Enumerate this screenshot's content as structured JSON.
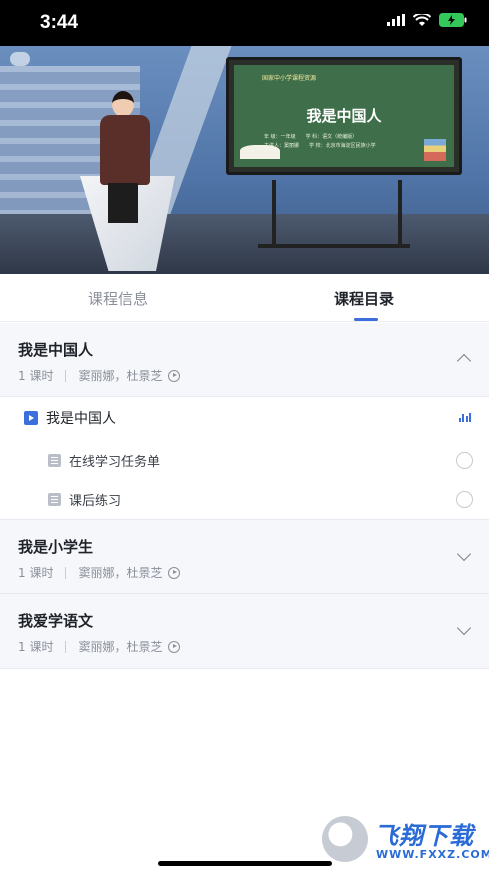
{
  "status_bar": {
    "time": "3:44"
  },
  "video": {
    "board_small": "国家中小学课程资源",
    "board_title": "我是中国人",
    "board_meta_1": "年 级：一年级　　学 科：语文（统编版）",
    "board_meta_2": "主讲人：窦丽娜　　学 校：北京市海淀区民族小学"
  },
  "tabs": [
    {
      "label": "课程信息",
      "active": false
    },
    {
      "label": "课程目录",
      "active": true
    }
  ],
  "sections": [
    {
      "title": "我是中国人",
      "hours": "1 课时",
      "teachers": "窦丽娜，杜景芝",
      "expanded": true,
      "lesson": {
        "title": "我是中国人"
      },
      "tasks": [
        "在线学习任务单",
        "课后练习"
      ]
    },
    {
      "title": "我是小学生",
      "hours": "1 课时",
      "teachers": "窦丽娜，杜景芝",
      "expanded": false
    },
    {
      "title": "我爱学语文",
      "hours": "1 课时",
      "teachers": "窦丽娜，杜景芝",
      "expanded": false
    }
  ],
  "watermark": {
    "brand": "飞翔下载",
    "url": "WWW.FXXZ.COM"
  },
  "colors": {
    "accent": "#3b6fdc",
    "section_bg": "#f5f7fb"
  },
  "icons": [
    "wifi-icon",
    "battery-icon",
    "video-lesson-icon",
    "document-icon",
    "chevron-up-icon",
    "chevron-down-icon",
    "play-circle-icon",
    "playing-bars-icon"
  ]
}
